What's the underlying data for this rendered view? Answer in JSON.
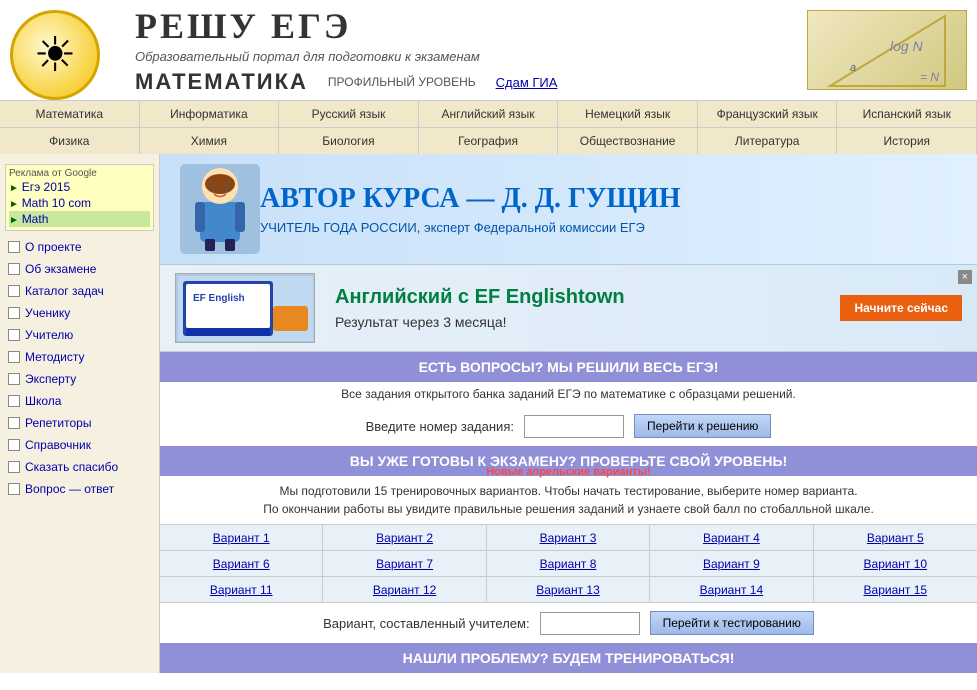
{
  "header": {
    "title": "РЕШУ ЕГЭ",
    "subtitle": "Образовательный портал для подготовки к экзаменам",
    "math_title": "МАТЕМАТИКА",
    "math_level": "ПРОФИЛЬНЫЙ УРОВЕНЬ",
    "gia_link": "Сдам ГИА"
  },
  "nav_top": [
    "Математика",
    "Информатика",
    "Русский язык",
    "Английский язык",
    "Немецкий язык",
    "Французский язык",
    "Испанский язык"
  ],
  "nav_bottom": [
    "Физика",
    "Химия",
    "Биология",
    "География",
    "Обществознание",
    "Литература",
    "История"
  ],
  "sidebar": {
    "ads_label": "Реклама от Google",
    "ad_links": [
      {
        "text": "Егэ 2015",
        "active": false
      },
      {
        "text": "Math 10 com",
        "active": false
      },
      {
        "text": "Math",
        "active": true
      }
    ],
    "menu_items": [
      "О проекте",
      "Об экзамене",
      "Каталог задач",
      "Ученику",
      "Учителю",
      "Методисту",
      "Эксперту",
      "Школа",
      "Репетиторы",
      "Справочник",
      "Сказать спасибо",
      "Вопрос — ответ"
    ]
  },
  "author_banner": {
    "prefix": "АВТОР КУРСА —",
    "name": "Д. Д. ГУЩИН",
    "title": "УЧИТЕЛЬ ГОДА РОССИИ, эксперт Федеральной комиссии ЕГЭ"
  },
  "eng_banner": {
    "title": "Английский с EF Englishtown",
    "subtitle": "Результат через 3 месяца!",
    "button": "Начните сейчас",
    "close": "×"
  },
  "questions_section": {
    "header": "ЕСТЬ ВОПРОСЫ? МЫ РЕШИЛИ ВЕСЬ ЕГЭ!",
    "subtitle": "Все задания открытого банка заданий ЕГЭ по математике с образцами решений.",
    "task_label": "Введите номер задания:",
    "task_btn": "Перейти к решению",
    "task_placeholder": ""
  },
  "variants_section": {
    "header": "ВЫ УЖЕ ГОТОВЫ К ЭКЗАМЕНУ? ПРОВЕРЬТЕ СВОЙ УРОВЕНЬ!",
    "new_label": "Новые апрельские варианты!",
    "desc_line1": "Мы подготовили 15 тренировочных вариантов. Чтобы начать тестирование, выберите номер варианта.",
    "desc_line2": "По окончании работы вы увидите правильные решения заданий и узнаете свой балл по стобалльной шкале.",
    "variants": [
      "Вариант 1",
      "Вариант 2",
      "Вариант 3",
      "Вариант 4",
      "Вариант 5",
      "Вариант 6",
      "Вариант 7",
      "Вариант 8",
      "Вариант 9",
      "Вариант 10",
      "Вариант 11",
      "Вариант 12",
      "Вариант 13",
      "Вариант 14",
      "Вариант 15"
    ],
    "teacher_label": "Вариант, составленный учителем:",
    "teacher_btn": "Перейти к тестированию",
    "teacher_placeholder": ""
  },
  "bottom_section": {
    "header": "НАШЛИ ПРОБЛЕМУ? БУДЕМ ТРЕНИРОВАТЬСЯ!"
  }
}
